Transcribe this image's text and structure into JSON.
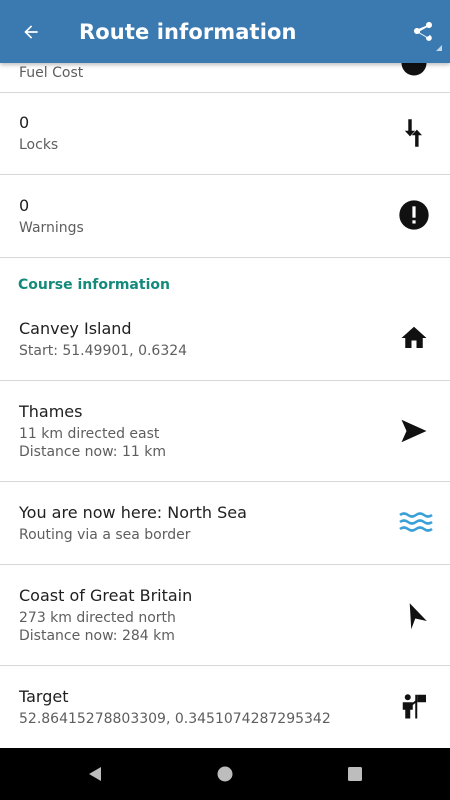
{
  "appbar": {
    "title": "Route information",
    "back_icon": "arrow-left-icon",
    "share_icon": "share-icon"
  },
  "rows": [
    {
      "value": "",
      "label": "Fuel Cost",
      "icon": "fuel-icon"
    },
    {
      "value": "0",
      "label": "Locks",
      "icon": "swap-vertical-icon"
    },
    {
      "value": "0",
      "label": "Warnings",
      "icon": "alert-circle-icon"
    }
  ],
  "course": {
    "header": "Course information",
    "items": [
      {
        "title": "Canvey Island",
        "line1": "Start: 51.49901, 0.6324",
        "line2": "",
        "icon": "home-icon"
      },
      {
        "title": "Thames",
        "line1": "11 km directed east",
        "line2": "Distance now: 11 km",
        "icon": "navigation-east-icon"
      },
      {
        "title": "You are now here: North Sea",
        "line1": "Routing via a sea border",
        "line2": "",
        "icon": "waves-icon"
      },
      {
        "title": "Coast of Great Britain",
        "line1": "273 km directed north",
        "line2": "Distance now: 284 km",
        "icon": "navigation-north-icon"
      },
      {
        "title": "Target",
        "line1": "52.86415278803309, 0.3451074287295342",
        "line2": "",
        "icon": "person-flag-icon"
      }
    ]
  },
  "colors": {
    "appbar": "#3a7ab0",
    "section_header": "#138a7c",
    "waves": "#3aa0d8"
  }
}
